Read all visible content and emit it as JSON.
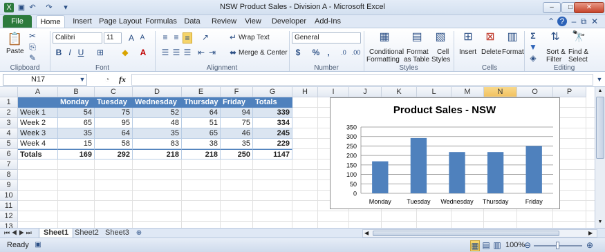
{
  "window": {
    "title": "NSW Product Sales - Division A  -  Microsoft Excel"
  },
  "tabs": [
    "File",
    "Home",
    "Insert",
    "Page Layout",
    "Formulas",
    "Data",
    "Review",
    "View",
    "Developer",
    "Add-Ins"
  ],
  "ribbon": {
    "clipboard": {
      "paste": "Paste",
      "label": "Clipboard"
    },
    "font": {
      "name": "Calibri",
      "size": "11",
      "label": "Font"
    },
    "alignment": {
      "wrap": "Wrap Text",
      "merge": "Merge & Center",
      "label": "Alignment"
    },
    "number": {
      "format": "General",
      "currency": "$",
      "percent": "%",
      "comma": ",",
      "label": "Number"
    },
    "styles": {
      "cond1": "Conditional",
      "cond2": "Formatting",
      "fmt1": "Format",
      "fmt2": "as Table",
      "cell1": "Cell",
      "cell2": "Styles",
      "label": "Styles"
    },
    "cells": {
      "insert": "Insert",
      "delete": "Delete",
      "format": "Format",
      "label": "Cells"
    },
    "editing": {
      "sigma": "Σ",
      "sort1": "Sort &",
      "sort2": "Filter",
      "find1": "Find &",
      "find2": "Select",
      "label": "Editing"
    }
  },
  "formula_bar": {
    "name_box": "N17",
    "fx": "fx"
  },
  "grid": {
    "columns": [
      "A",
      "B",
      "C",
      "D",
      "E",
      "F",
      "G",
      "H",
      "I",
      "J",
      "K",
      "L",
      "M",
      "N",
      "O",
      "P"
    ],
    "rows": [
      "1",
      "2",
      "3",
      "4",
      "5",
      "6",
      "7",
      "8",
      "9",
      "10",
      "11",
      "12",
      "13"
    ],
    "selected_column": "N",
    "table": {
      "header": [
        "",
        "Monday",
        "Tuesday",
        "Wednesday",
        "Thursday",
        "Friday",
        "Totals"
      ],
      "rows": [
        [
          "Week 1",
          "54",
          "75",
          "52",
          "64",
          "94",
          "339"
        ],
        [
          "Week 2",
          "65",
          "95",
          "48",
          "51",
          "75",
          "334"
        ],
        [
          "Week 3",
          "35",
          "64",
          "35",
          "65",
          "46",
          "245"
        ],
        [
          "Week 4",
          "15",
          "58",
          "83",
          "38",
          "35",
          "229"
        ]
      ],
      "totals": [
        "Totals",
        "169",
        "292",
        "218",
        "218",
        "250",
        "1147"
      ]
    }
  },
  "chart_data": {
    "type": "bar",
    "title": "Product Sales - NSW",
    "categories": [
      "Monday",
      "Tuesday",
      "Wednesday",
      "Thursday",
      "Friday"
    ],
    "values": [
      169,
      292,
      218,
      218,
      250
    ],
    "yticks": [
      "350",
      "300",
      "250",
      "200",
      "150",
      "100",
      "50",
      "0"
    ],
    "ylim": [
      0,
      350
    ],
    "grid": true,
    "color": "#4f81bd"
  },
  "sheets": [
    "Sheet1",
    "Sheet2",
    "Sheet3"
  ],
  "status": {
    "ready": "Ready",
    "zoom": "100%"
  }
}
